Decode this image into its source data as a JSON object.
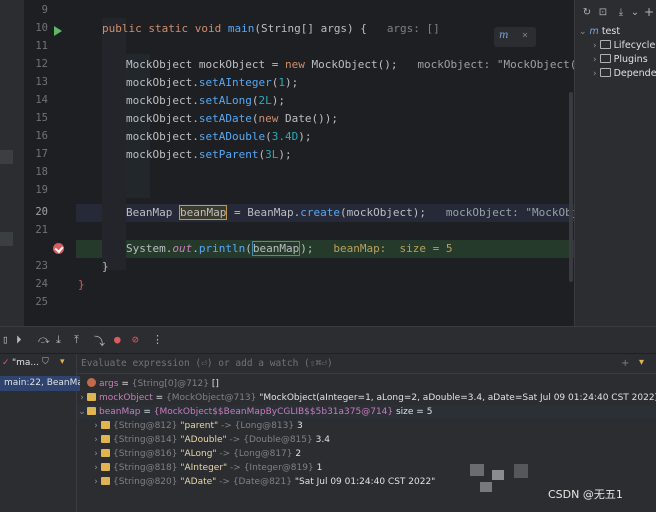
{
  "gutter": {
    "lines": [
      "9",
      "10",
      "11",
      "12",
      "13",
      "14",
      "15",
      "16",
      "17",
      "18",
      "19",
      "20",
      "21",
      "22",
      "23",
      "24",
      "25"
    ],
    "current_line": "20"
  },
  "editor": {
    "l10_sig": "public static void main(String[] args) {",
    "l10_hint": "args: []",
    "l12_code": "MockObject mockObject = new MockObject();",
    "l12_hint": "mockObject: \"MockObject(aInt",
    "l13": "mockObject.setAInteger(1);",
    "l14": "mockObject.setALong(2L);",
    "l15": "mockObject.setADate(new Date());",
    "l16": "mockObject.setADouble(3.4D);",
    "l17": "mockObject.setParent(3L);",
    "l20_a": "BeanMap ",
    "l20_var": "beanMap",
    "l20_b": " = BeanMap.create(mockObject);",
    "l20_hint": "mockObject: \"MockObjec",
    "l22_a": "System.out.println(",
    "l22_var": "beanMap",
    "l22_b": ");",
    "l22_hint": "beanMap:  size = 5",
    "l23": "}",
    "l24": "}",
    "hint_close": "×",
    "colors": {
      "keyword": "#cf8e6d",
      "function": "#56a8f5",
      "breakpoint_line": "#263a2c",
      "current_line": "#2a3145"
    }
  },
  "project": {
    "root": "test",
    "items": [
      "Lifecycle",
      "Plugins",
      "Depende"
    ]
  },
  "debug": {
    "frame_filter": "\"ma...",
    "frame_selected": "main:22, BeanMa",
    "eval_placeholder": "Evaluate expression (⏎) or add a watch (⇧⌘⏎)",
    "vars": [
      {
        "name": "args",
        "eq": " = ",
        "type": "{String[0]@712}",
        "val": " []"
      },
      {
        "name": "mockObject",
        "eq": " = ",
        "type": "{MockObject@713}",
        "val": " \"MockObject(aInteger=1, aLong=2, aDouble=3.4, aDate=Sat Jul 09 01:24:40 CST 2022)\""
      },
      {
        "name": "beanMap",
        "eq": " = ",
        "type": "{MockObject$$BeanMapByCGLIB$$5b31a375@714}",
        "val": "  size = 5"
      }
    ],
    "entries": [
      {
        "key_type": "{String@812}",
        "key": " \"parent\"",
        "arrow": " -> ",
        "val_type": "{Long@813}",
        "val": " 3"
      },
      {
        "key_type": "{String@814}",
        "key": " \"ADouble\"",
        "arrow": " -> ",
        "val_type": "{Double@815}",
        "val": " 3.4"
      },
      {
        "key_type": "{String@816}",
        "key": " \"ALong\"",
        "arrow": " -> ",
        "val_type": "{Long@817}",
        "val": " 2"
      },
      {
        "key_type": "{String@818}",
        "key": " \"AInteger\"",
        "arrow": " -> ",
        "val_type": "{Integer@819}",
        "val": " 1"
      },
      {
        "key_type": "{String@820}",
        "key": " \"ADate\"",
        "arrow": " -> ",
        "val_type": "{Date@821}",
        "val": " \"Sat Jul 09 01:24:40 CST 2022\""
      }
    ]
  },
  "watermark": "CSDN @无五1"
}
